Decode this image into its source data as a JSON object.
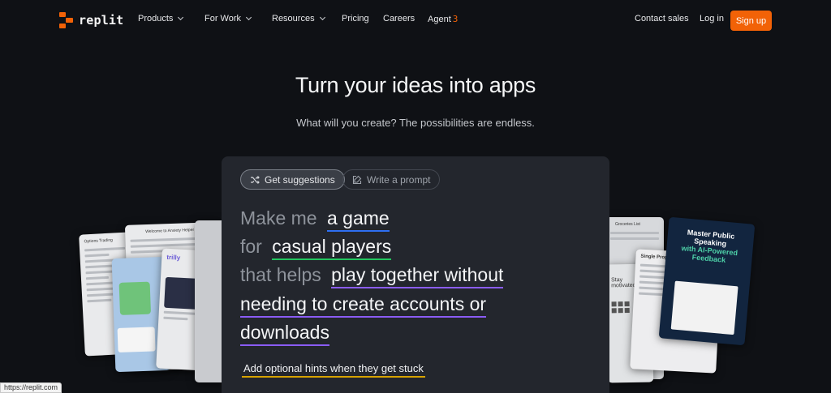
{
  "nav": {
    "logo_text": "replit",
    "items": [
      {
        "label": "Products",
        "dropdown": true
      },
      {
        "label": "For Work",
        "dropdown": true
      },
      {
        "label": "Resources",
        "dropdown": true
      },
      {
        "label": "Pricing",
        "dropdown": false
      },
      {
        "label": "Careers",
        "dropdown": false
      },
      {
        "label": "Agent",
        "dropdown": false
      }
    ],
    "agent_badge": "3",
    "contact_label": "Contact sales",
    "login_label": "Log in",
    "signup_label": "Sign up"
  },
  "hero": {
    "title": "Turn your ideas into apps",
    "subtitle": "What will you create? The possibilities are endless."
  },
  "panel": {
    "suggest_label": "Get suggestions",
    "write_label": "Write a prompt",
    "lines": [
      {
        "prefix": "Make me",
        "value": "a game"
      },
      {
        "prefix": "for",
        "value": "casual players"
      },
      {
        "prefix": "that helps",
        "value": "play together without"
      },
      {
        "prefix": "",
        "value": "needing to create accounts or"
      },
      {
        "prefix": "",
        "value": "downloads"
      }
    ],
    "hint": "Add optional hints when they get stuck"
  },
  "cards": {
    "anxiety_title": "Welcome to Anxiety Helper",
    "property_title": "Single Property Loan Calculator",
    "stay_title": "Stay motivated",
    "trilly_title": "trilly",
    "groceries_title": "Groceries List",
    "speaking_title": "Master Public Speaking",
    "speaking_highlight": "with AI-Powered Feedback",
    "options_title": "Options Trading"
  },
  "status_bar": "https://replit.com",
  "colors": {
    "accent": "#f26207",
    "background": "#0f1115",
    "panel": "#23262d",
    "underline_blue": "#2e6ff2",
    "underline_green": "#22c55e",
    "underline_purple": "#8b5cf6",
    "underline_yellow": "#d6a300"
  }
}
